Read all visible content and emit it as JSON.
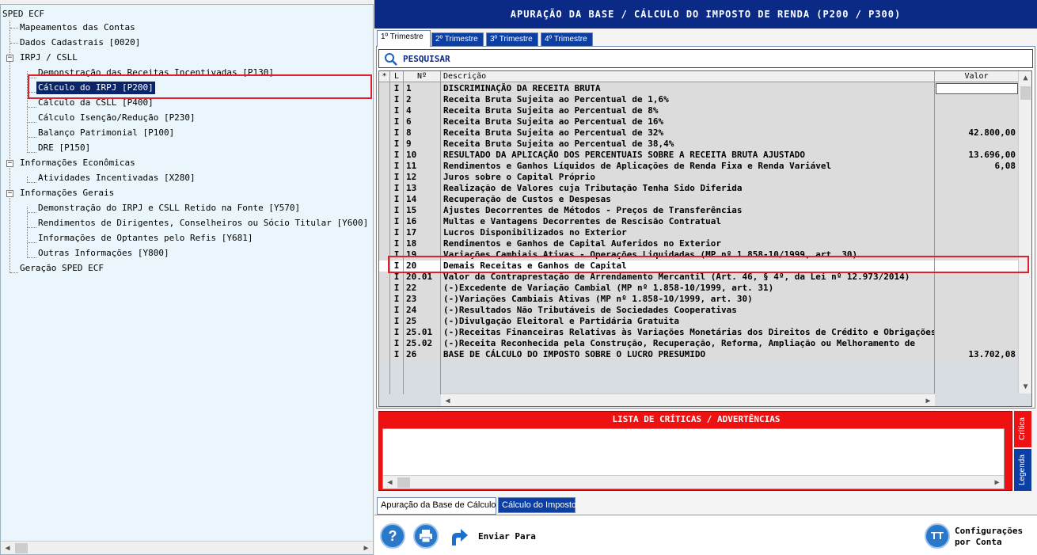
{
  "tree": {
    "root": "SPED ECF",
    "items": [
      {
        "label": "Mapeamentos das Contas",
        "level": 1
      },
      {
        "label": "Dados Cadastrais [0020]",
        "level": 1
      },
      {
        "label": "IRPJ / CSLL",
        "level": 1,
        "expanded": true
      },
      {
        "label": "Demonstração das Receitas Incentivadas [P130]",
        "level": 2
      },
      {
        "label": "Cálculo do IRPJ [P200]",
        "level": 2,
        "selected": true
      },
      {
        "label": "Cálculo da CSLL [P400]",
        "level": 2
      },
      {
        "label": "Cálculo Isenção/Redução [P230]",
        "level": 2
      },
      {
        "label": "Balanço Patrimonial [P100]",
        "level": 2
      },
      {
        "label": "DRE [P150]",
        "level": 2
      },
      {
        "label": "Informações Econômicas",
        "level": 1,
        "expanded": true
      },
      {
        "label": "Atividades Incentivadas [X280]",
        "level": 2
      },
      {
        "label": "Informações Gerais",
        "level": 1,
        "expanded": true
      },
      {
        "label": "Demonstração do IRPJ e CSLL Retido na Fonte [Y570]",
        "level": 2
      },
      {
        "label": "Rendimentos de Dirigentes, Conselheiros ou Sócio Titular [Y600]",
        "level": 2
      },
      {
        "label": "Informações de Optantes pelo Refis [Y681]",
        "level": 2
      },
      {
        "label": "Outras Informações [Y800]",
        "level": 2
      },
      {
        "label": "Geração SPED ECF",
        "level": 1
      }
    ]
  },
  "panel": {
    "title": "APURAÇÃO DA BASE / CÁLCULO DO IMPOSTO DE RENDA (P200 / P300)",
    "tabs": [
      "1º Trimestre",
      "2º Trimestre",
      "3º Trimestre",
      "4º Trimestre"
    ],
    "search_label": "PESQUISAR"
  },
  "grid": {
    "headers": [
      "*",
      "L",
      "Nº",
      "Descrição",
      "Valor"
    ],
    "rows": [
      {
        "l": "I",
        "n": "1",
        "d": "DISCRIMINAÇÃO DA RECEITA BRUTA",
        "v": ""
      },
      {
        "l": "I",
        "n": "2",
        "d": "Receita Bruta Sujeita ao Percentual de 1,6%",
        "v": ""
      },
      {
        "l": "I",
        "n": "4",
        "d": "Receita Bruta Sujeita ao Percentual de 8%",
        "v": ""
      },
      {
        "l": "I",
        "n": "6",
        "d": "Receita Bruta Sujeita ao Percentual de 16%",
        "v": ""
      },
      {
        "l": "I",
        "n": "8",
        "d": "Receita Bruta Sujeita ao Percentual de 32%",
        "v": "42.800,00"
      },
      {
        "l": "I",
        "n": "9",
        "d": "Receita Bruta Sujeita ao Percentual de 38,4%",
        "v": ""
      },
      {
        "l": "I",
        "n": "10",
        "d": "RESULTADO DA APLICAÇÃO DOS PERCENTUAIS SOBRE A RECEITA BRUTA AJUSTADO",
        "v": "13.696,00"
      },
      {
        "l": "I",
        "n": "11",
        "d": "Rendimentos e Ganhos Líquidos de Aplicações de Renda Fixa e Renda Variável",
        "v": "6,08"
      },
      {
        "l": "I",
        "n": "12",
        "d": "Juros sobre o Capital Próprio",
        "v": ""
      },
      {
        "l": "I",
        "n": "13",
        "d": "Realização de Valores cuja Tributação Tenha Sido Diferida",
        "v": ""
      },
      {
        "l": "I",
        "n": "14",
        "d": "Recuperação de Custos e Despesas",
        "v": ""
      },
      {
        "l": "I",
        "n": "15",
        "d": "Ajustes Decorrentes de Métodos - Preços de Transferências",
        "v": ""
      },
      {
        "l": "I",
        "n": "16",
        "d": "Multas e Vantagens Decorrentes de Rescisão Contratual",
        "v": ""
      },
      {
        "l": "I",
        "n": "17",
        "d": "Lucros Disponibilizados no Exterior",
        "v": ""
      },
      {
        "l": "I",
        "n": "18",
        "d": "Rendimentos e Ganhos de Capital Auferidos no Exterior",
        "v": ""
      },
      {
        "l": "I",
        "n": "19",
        "d": "Variações Cambiais Ativas - Operações Liquidadas (MP nº 1.858-10/1999, art. 30)",
        "v": ""
      },
      {
        "l": "I",
        "n": "20",
        "d": "Demais Receitas e Ganhos de Capital",
        "v": ""
      },
      {
        "l": "I",
        "n": "20.01",
        "d": "Valor da Contraprestação de Arrendamento Mercantil (Art. 46, § 4º, da Lei nº 12.973/2014)",
        "v": ""
      },
      {
        "l": "I",
        "n": "22",
        "d": "(-)Excedente de Variação Cambial (MP nº 1.858-10/1999, art. 31)",
        "v": ""
      },
      {
        "l": "I",
        "n": "23",
        "d": "(-)Variações Cambiais Ativas (MP nº 1.858-10/1999, art. 30)",
        "v": ""
      },
      {
        "l": "I",
        "n": "24",
        "d": "(-)Resultados Não Tributáveis de Sociedades Cooperativas",
        "v": ""
      },
      {
        "l": "I",
        "n": "25",
        "d": "(-)Divulgação Eleitoral e Partidária Gratuita",
        "v": ""
      },
      {
        "l": "I",
        "n": "25.01",
        "d": "(-)Receitas Financeiras Relativas às Variações Monetárias dos Direitos de Crédito e Obrigações",
        "v": ""
      },
      {
        "l": "I",
        "n": "25.02",
        "d": "(-)Receita Reconhecida pela Construção, Recuperação, Reforma, Ampliação ou Melhoramento de",
        "v": ""
      },
      {
        "l": "I",
        "n": "26",
        "d": "BASE DE CÁLCULO DO IMPOSTO SOBRE O LUCRO PRESUMIDO",
        "v": "13.702,08"
      }
    ]
  },
  "critics": {
    "title": "LISTA DE CRÍTICAS / ADVERTÊNCIAS",
    "side_tabs": [
      "Crítica",
      "Legenda"
    ]
  },
  "bottom_tabs": [
    "Apuração da Base de Cálculo",
    "Cálculo do Imposto"
  ],
  "toolbar": {
    "help_glyph": "?",
    "send_label": "Enviar Para",
    "config_line1": "Configurações",
    "config_line2": "por Conta",
    "config_glyph": "TT"
  },
  "icons": {
    "help": "help-icon",
    "print": "printer-icon",
    "send": "send-arrow-icon",
    "config": "config-icon",
    "search": "search-icon"
  },
  "colors": {
    "title_bar": "#0b2a86",
    "tab_active": "#ffffff",
    "tab_inactive": "#0b3fa3",
    "critics_bg": "#ee1111",
    "highlight_box": "#e0202c",
    "selected_bg": "#0a246a"
  }
}
